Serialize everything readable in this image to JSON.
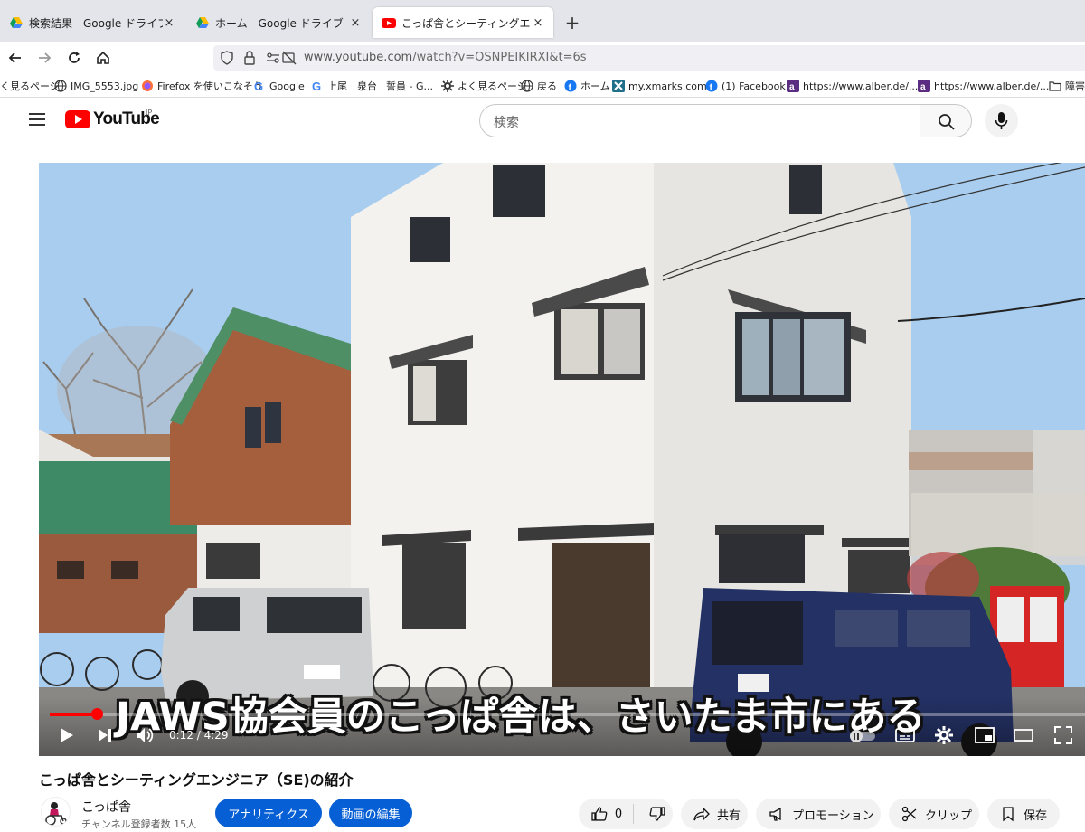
{
  "browser": {
    "tabs": [
      {
        "title": "検索結果 - Google ドライブ",
        "icon": "google-drive-icon",
        "close": "×"
      },
      {
        "title": "ホーム - Google ドライブ",
        "icon": "google-drive-icon",
        "close": "×"
      },
      {
        "title": "こっぱ舎とシーティングエンジニア（SE",
        "icon": "youtube-icon",
        "close": "×"
      }
    ],
    "new_tab": "+",
    "url_domain": "www.youtube.com",
    "url_path": "/watch?v=OSNPEIKIRXI&t=6s",
    "bookmarks": [
      {
        "label": "く見るページ",
        "icon": ""
      },
      {
        "label": "IMG_5553.jpg",
        "icon": "globe-icon"
      },
      {
        "label": "Firefox を使いこなそう",
        "icon": "firefox-icon"
      },
      {
        "label": "Google",
        "icon": "google-icon"
      },
      {
        "label": "上尾",
        "icon": "google-icon"
      },
      {
        "label": "泉台",
        "icon": ""
      },
      {
        "label": "誓員 - G...",
        "icon": ""
      },
      {
        "label": "よく見るページ",
        "icon": "gear-icon"
      },
      {
        "label": "戻る",
        "icon": "globe-icon"
      },
      {
        "label": "ホーム",
        "icon": "facebook-icon"
      },
      {
        "label": "my.xmarks.com",
        "icon": "xmarks-icon"
      },
      {
        "label": "(1) Facebook",
        "icon": "facebook-icon"
      },
      {
        "label": "https://www.alber.de/...",
        "icon": "alber-icon"
      },
      {
        "label": "https://www.alber.de/...",
        "icon": "alber-icon"
      },
      {
        "label": "障害",
        "icon": "folder-icon"
      }
    ]
  },
  "youtube": {
    "logo_text": "YouTube",
    "region": "JP",
    "search_placeholder": "検索",
    "video": {
      "subtitle": "JAWS協会員のこっぱ舎は、さいたま市にある",
      "time": "0:12 / 4:29",
      "progress_fraction": 0.045
    },
    "title": "こっぱ舎とシーティングエンジニア（SE)の紹介",
    "channel_name": "こっぱ舎",
    "subscribers": "チャンネル登録者数 15人",
    "buttons": {
      "analytics": "アナリティクス",
      "edit_video": "動画の編集"
    },
    "actions": {
      "likes": "0",
      "share": "共有",
      "promotion": "プロモーション",
      "clip": "クリップ",
      "save": "保存"
    }
  },
  "colors": {
    "youtube_red": "#ff0000",
    "action_blue": "#065fd4",
    "tab_strip": "#e3e5ea"
  }
}
